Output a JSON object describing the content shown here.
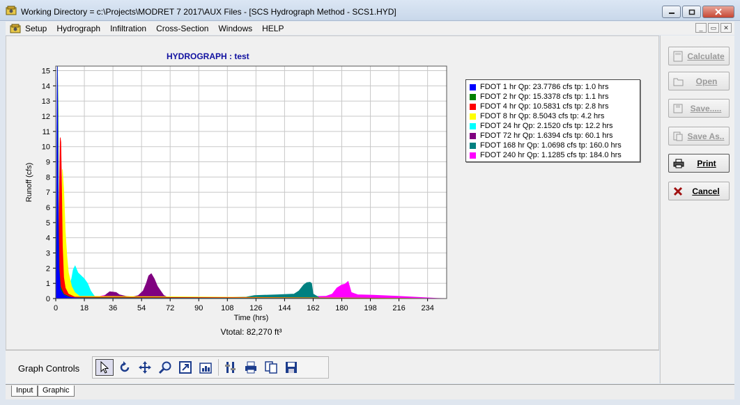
{
  "window": {
    "title": "Working Directory = c:\\Projects\\MODRET 7 2017\\AUX Files - [SCS  Hydrograph Method - SCS1.HYD]",
    "buttons": [
      "minimize",
      "restore",
      "close"
    ]
  },
  "menu": {
    "items": [
      "Setup",
      "Hydrograph",
      "Infiltration",
      "Cross-Section",
      "Windows",
      "HELP"
    ]
  },
  "graph": {
    "title": "HYDROGRAPH : test",
    "vtotal": "Vtotal:  82,270 ft³"
  },
  "chart_data": {
    "type": "area",
    "title": "HYDROGRAPH : test",
    "xlabel": "Time (hrs)",
    "ylabel": "Runoff (cfs)",
    "xlim": [
      0,
      246
    ],
    "ylim": [
      0,
      15.3
    ],
    "xticks": [
      0,
      18,
      36,
      54,
      72,
      90,
      108,
      126,
      144,
      162,
      180,
      198,
      216,
      234
    ],
    "yticks": [
      0,
      1,
      2,
      3,
      4,
      5,
      6,
      7,
      8,
      9,
      10,
      11,
      12,
      13,
      14,
      15
    ],
    "grid": true,
    "legend_position": "top-right",
    "series": [
      {
        "name": "FDOT 1 hr",
        "legend": "FDOT 1 hr  Qp:  23.7786 cfs  tp:    1.0 hrs",
        "color": "#0000ff",
        "x": [
          0,
          0.5,
          0.8,
          1.0,
          1.2,
          1.5,
          2,
          3,
          5,
          8,
          15,
          246
        ],
        "y": [
          0,
          2,
          12,
          15.3,
          12,
          6,
          2,
          0.6,
          0.25,
          0.1,
          0.02,
          0
        ]
      },
      {
        "name": "FDOT 2 hr",
        "legend": "FDOT 2 hr  Qp:  15.3378 cfs  tp:    1.1 hrs",
        "color": "#008000",
        "x": [
          0,
          0.3,
          0.7,
          1.1,
          1.4,
          1.7,
          2.2,
          3,
          5,
          10,
          246
        ],
        "y": [
          0,
          0.5,
          10,
          15.3,
          12.5,
          5,
          2,
          0.8,
          0.3,
          0.05,
          0
        ]
      },
      {
        "name": "FDOT 4 hr",
        "legend": "FDOT 4 hr  Qp:  10.5831 cfs  tp:    2.8 hrs",
        "color": "#ff0000",
        "x": [
          0,
          1,
          1.8,
          2.4,
          2.8,
          3.2,
          3.6,
          4.2,
          5,
          6,
          8,
          12,
          246
        ],
        "y": [
          0,
          1.2,
          3,
          8,
          10.6,
          10.3,
          8,
          3.5,
          1.4,
          0.7,
          0.3,
          0.1,
          0
        ]
      },
      {
        "name": "FDOT 8 hr",
        "legend": "FDOT 8 hr  Qp:   8.5043 cfs  tp:    4.2 hrs",
        "color": "#ffff00",
        "x": [
          0,
          2,
          3,
          3.8,
          4.2,
          5,
          6,
          7,
          8,
          10,
          12,
          15,
          246
        ],
        "y": [
          0,
          0.6,
          2.5,
          6.5,
          8.5,
          7.2,
          4.4,
          2.8,
          1.7,
          0.8,
          0.4,
          0.15,
          0
        ]
      },
      {
        "name": "FDOT 24 hr",
        "legend": "FDOT 24 hr  Qp:   2.1520 cfs  tp:   12.2 hrs",
        "color": "#00ffff",
        "x": [
          0,
          4,
          8,
          10,
          11,
          12.2,
          14,
          16,
          18,
          20,
          22,
          24,
          26,
          246
        ],
        "y": [
          0,
          0.3,
          0.7,
          1.3,
          1.9,
          2.15,
          1.7,
          1.5,
          1.3,
          1.0,
          0.5,
          0.2,
          0,
          0
        ]
      },
      {
        "name": "FDOT 72 hr",
        "legend": "FDOT 72 hr  Qp:   1.6394 cfs  tp:   60.1 hrs",
        "color": "#800080",
        "x": [
          0,
          8,
          12,
          16,
          22,
          30,
          32,
          34,
          38,
          40,
          44,
          48,
          52,
          55,
          57,
          58.5,
          60.1,
          62,
          64,
          66,
          68,
          72,
          246
        ],
        "y": [
          0,
          0.1,
          0.15,
          0.1,
          0.05,
          0.1,
          0.3,
          0.45,
          0.4,
          0.25,
          0.15,
          0.1,
          0.2,
          0.5,
          1.0,
          1.5,
          1.64,
          1.3,
          0.8,
          0.5,
          0.2,
          0,
          0
        ]
      },
      {
        "name": "FDOT 168 hr",
        "legend": "FDOT 168 hr  Qp:   1.0698 cfs  tp:  160.0 hrs",
        "color": "#008080",
        "x": [
          0,
          60,
          100,
          120,
          125,
          140,
          150,
          153,
          156,
          158,
          160,
          161,
          162,
          166,
          246
        ],
        "y": [
          0,
          0.02,
          0.05,
          0.1,
          0.2,
          0.25,
          0.3,
          0.5,
          0.9,
          1.05,
          1.07,
          1.0,
          0.3,
          0.05,
          0
        ]
      },
      {
        "name": "FDOT 240 hr",
        "legend": "FDOT 240 hr  Qp:   1.1285 cfs  tp:  184.0 hrs",
        "color": "#ff00ff",
        "x": [
          0,
          4,
          6,
          10,
          16,
          26,
          30,
          34,
          40,
          60,
          90,
          120,
          150,
          170,
          174,
          177,
          180,
          182,
          184,
          186,
          190,
          200,
          215,
          234,
          240,
          246
        ],
        "y": [
          0,
          0.1,
          0.1,
          0.05,
          0.05,
          0.1,
          0.2,
          0.3,
          0.15,
          0.05,
          0.03,
          0.05,
          0.1,
          0.15,
          0.3,
          0.7,
          0.9,
          0.95,
          1.13,
          0.4,
          0.25,
          0.22,
          0.15,
          0.05,
          0.02,
          0
        ]
      }
    ]
  },
  "graph_controls": {
    "label": "Graph Controls",
    "tools": [
      "pointer-icon",
      "rotate-icon",
      "move-icon",
      "zoom-icon",
      "export-icon",
      "chart-type-icon",
      "settings-icon",
      "print-icon",
      "copy-icon",
      "save-icon"
    ]
  },
  "side_buttons": {
    "calculate": "Calculate",
    "open": "Open",
    "save": "Save.....",
    "save_as": "Save As..",
    "print": "Print",
    "cancel": "Cancel"
  },
  "tabs": [
    "Input",
    "Graphic"
  ]
}
